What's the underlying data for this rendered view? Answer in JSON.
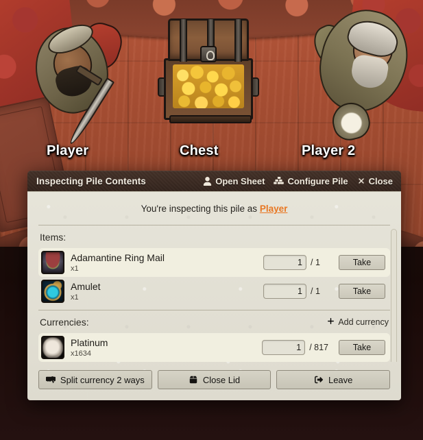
{
  "scene": {
    "tokens": [
      {
        "name": "Player"
      },
      {
        "name": "Chest"
      },
      {
        "name": "Player 2"
      }
    ]
  },
  "sheet": {
    "title": "Inspecting Pile Contents",
    "header_actions": [
      {
        "label": "Open Sheet",
        "icon": "user-icon"
      },
      {
        "label": "Configure Pile",
        "icon": "boxes-icon"
      },
      {
        "label": "Close",
        "icon": "close-icon"
      }
    ],
    "inspect_notice": {
      "prefix": "You're inspecting this pile as",
      "player_name": "Player",
      "link_color": "#e87722"
    },
    "sections": {
      "items": {
        "heading": "Items:",
        "rows": [
          {
            "name": "Adamantine Ring Mail",
            "quantity_label": "x1",
            "input_value": "1",
            "max_label": "/ 1",
            "take_label": "Take",
            "icon": "armor-icon",
            "hovered": true
          },
          {
            "name": "Amulet",
            "quantity_label": "x1",
            "input_value": "1",
            "max_label": "/ 1",
            "take_label": "Take",
            "icon": "amulet-icon",
            "hovered": false
          }
        ]
      },
      "currencies": {
        "heading": "Currencies:",
        "add_label": "Add currency",
        "add_icon": "plus-icon",
        "rows": [
          {
            "name": "Platinum",
            "quantity_label": "x1634",
            "input_value": "1",
            "max_label": "/ 817",
            "take_label": "Take",
            "icon": "platinum-coin-icon",
            "hovered": true
          }
        ]
      }
    },
    "footer_buttons": [
      {
        "label": "Split currency 2 ways",
        "icon": "split-icon"
      },
      {
        "label": "Close Lid",
        "icon": "box-icon"
      },
      {
        "label": "Leave",
        "icon": "exit-icon"
      }
    ]
  }
}
